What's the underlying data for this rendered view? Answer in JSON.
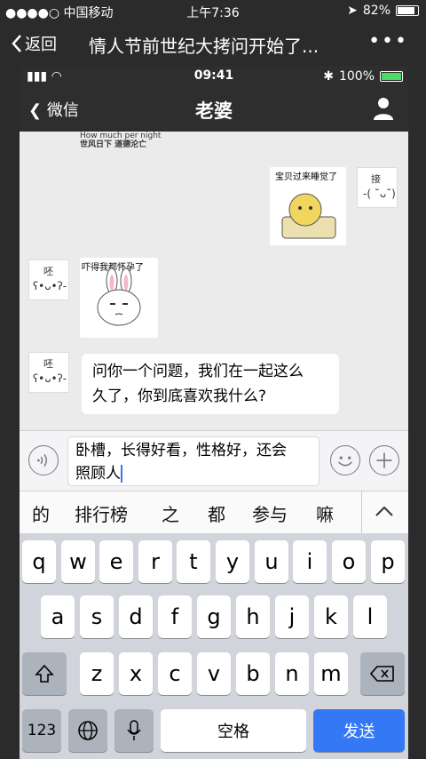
{
  "outer_status": {
    "carrier": "●●●●○ 中国移动",
    "time": "上午7:36",
    "battery": "82%"
  },
  "outer_nav": {
    "back_label": "返回",
    "title": "情人节前世纪大拷问开始了...",
    "more": "•••"
  },
  "inner_status": {
    "time": "09:41",
    "battery": "100%"
  },
  "chat_header": {
    "back_label": "微信",
    "title": "老婆"
  },
  "messages": {
    "top_fragment_line1": "How much per night",
    "top_fragment_line2": "世风日下 道德沦亡",
    "sticker_sleep_caption": "宝贝过来睡觉了",
    "avatar_right_label": "接",
    "avatar_left1_label": "呸",
    "sticker_pregnant_caption": "吓得我都怀孕了",
    "avatar_left2_label": "呸",
    "bubble_line1": "问你一个问题，我们在一起这么",
    "bubble_line2": "久了，你到底喜欢我什么?"
  },
  "input": {
    "line1": "卧槽，长得好看，性格好，还会",
    "line2": "照顾人"
  },
  "candidates": [
    "的",
    "排行榜",
    "之",
    "都",
    "参与",
    "嘛"
  ],
  "keyboard": {
    "row1": [
      "q",
      "w",
      "e",
      "r",
      "t",
      "y",
      "u",
      "i",
      "o",
      "p"
    ],
    "row2": [
      "a",
      "s",
      "d",
      "f",
      "g",
      "h",
      "j",
      "k",
      "l"
    ],
    "row3": [
      "z",
      "x",
      "c",
      "v",
      "b",
      "n",
      "m"
    ],
    "num_label": "123",
    "space_label": "空格",
    "send_label": "发送"
  },
  "colors": {
    "accent_send": "#3478f6",
    "nav_bg": "#2e2e2e",
    "chat_bg": "#ebebeb"
  }
}
